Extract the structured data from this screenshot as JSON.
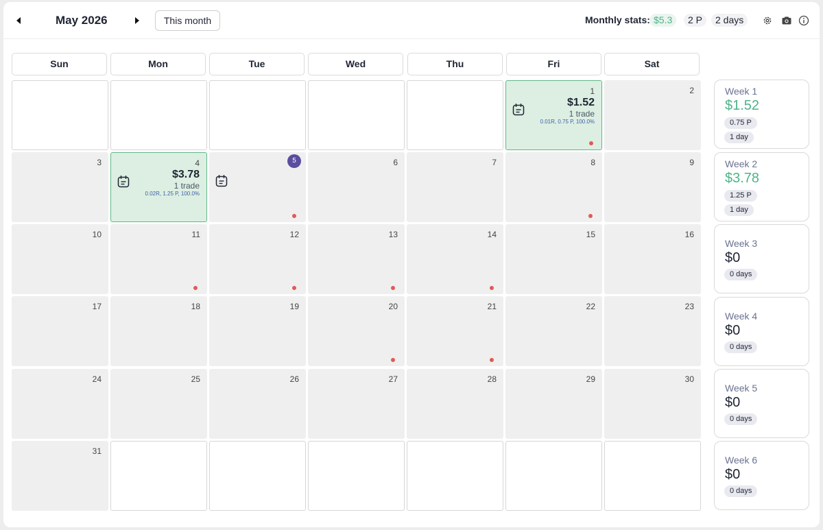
{
  "header": {
    "month_title": "May 2026",
    "this_month_label": "This month",
    "stats_label": "Monthly stats:",
    "stats_profit": "$5.3",
    "stats_p": "2 P",
    "stats_days": "2 days"
  },
  "weekdays": [
    "Sun",
    "Mon",
    "Tue",
    "Wed",
    "Thu",
    "Fri",
    "Sat"
  ],
  "days": {
    "d1": {
      "num": "1",
      "pnl": "$1.52",
      "trades": "1 trade",
      "info": "0.01R, 0.75 P, 100.0%"
    },
    "d2": {
      "num": "2"
    },
    "d3": {
      "num": "3"
    },
    "d4": {
      "num": "4",
      "pnl": "$3.78",
      "trades": "1 trade",
      "info": "0.02R, 1.25 P, 100.0%"
    },
    "d5": {
      "num": "5"
    },
    "d6": {
      "num": "6"
    },
    "d7": {
      "num": "7"
    },
    "d8": {
      "num": "8"
    },
    "d9": {
      "num": "9"
    },
    "d10": {
      "num": "10"
    },
    "d11": {
      "num": "11"
    },
    "d12": {
      "num": "12"
    },
    "d13": {
      "num": "13"
    },
    "d14": {
      "num": "14"
    },
    "d15": {
      "num": "15"
    },
    "d16": {
      "num": "16"
    },
    "d17": {
      "num": "17"
    },
    "d18": {
      "num": "18"
    },
    "d19": {
      "num": "19"
    },
    "d20": {
      "num": "20"
    },
    "d21": {
      "num": "21"
    },
    "d22": {
      "num": "22"
    },
    "d23": {
      "num": "23"
    },
    "d24": {
      "num": "24"
    },
    "d25": {
      "num": "25"
    },
    "d26": {
      "num": "26"
    },
    "d27": {
      "num": "27"
    },
    "d28": {
      "num": "28"
    },
    "d29": {
      "num": "29"
    },
    "d30": {
      "num": "30"
    },
    "d31": {
      "num": "31"
    }
  },
  "weeks": [
    {
      "title": "Week 1",
      "amount": "$1.52",
      "points": "0.75 P",
      "days": "1 day"
    },
    {
      "title": "Week 2",
      "amount": "$3.78",
      "points": "1.25 P",
      "days": "1 day"
    },
    {
      "title": "Week 3",
      "amount": "$0",
      "days": "0 days"
    },
    {
      "title": "Week 4",
      "amount": "$0",
      "days": "0 days"
    },
    {
      "title": "Week 5",
      "amount": "$0",
      "days": "0 days"
    },
    {
      "title": "Week 6",
      "amount": "$0",
      "days": "0 days"
    }
  ],
  "colors": {
    "profit": "#4eb38a",
    "today": "#5b4e9e",
    "marker": "#e05a56"
  }
}
